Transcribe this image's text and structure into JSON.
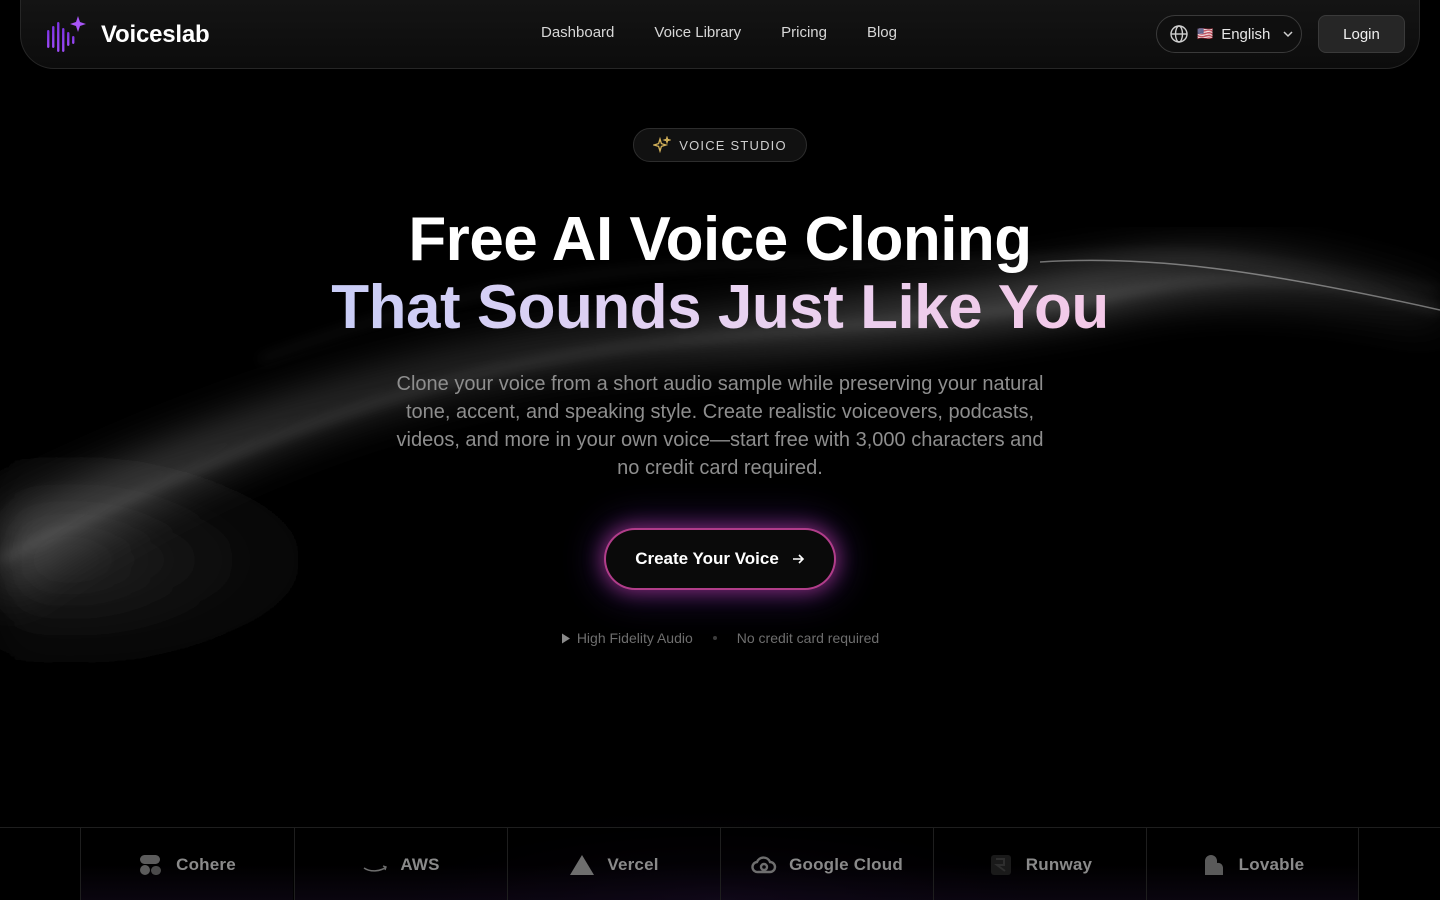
{
  "brand": {
    "name": "Voiceslab",
    "accent": "#8b3cf6"
  },
  "nav": {
    "links": [
      "Dashboard",
      "Voice Library",
      "Pricing",
      "Blog"
    ],
    "language": {
      "flag": "🇺🇸",
      "label": "English"
    },
    "login_label": "Login"
  },
  "hero": {
    "badge": "VOICE STUDIO",
    "title_line1": "Free AI Voice Cloning",
    "title_line2": "That Sounds Just Like You",
    "description": "Clone your voice from a short audio sample while preserving your natural tone, accent, and speaking style. Create realistic voiceovers, podcasts, videos, and more in your own voice—start free with 3,000 characters and no credit card required.",
    "cta_label": "Create Your Voice",
    "features": [
      "High Fidelity Audio",
      "No credit card required"
    ]
  },
  "partners": [
    "Cohere",
    "AWS",
    "Vercel",
    "Google Cloud",
    "Runway",
    "Lovable"
  ]
}
